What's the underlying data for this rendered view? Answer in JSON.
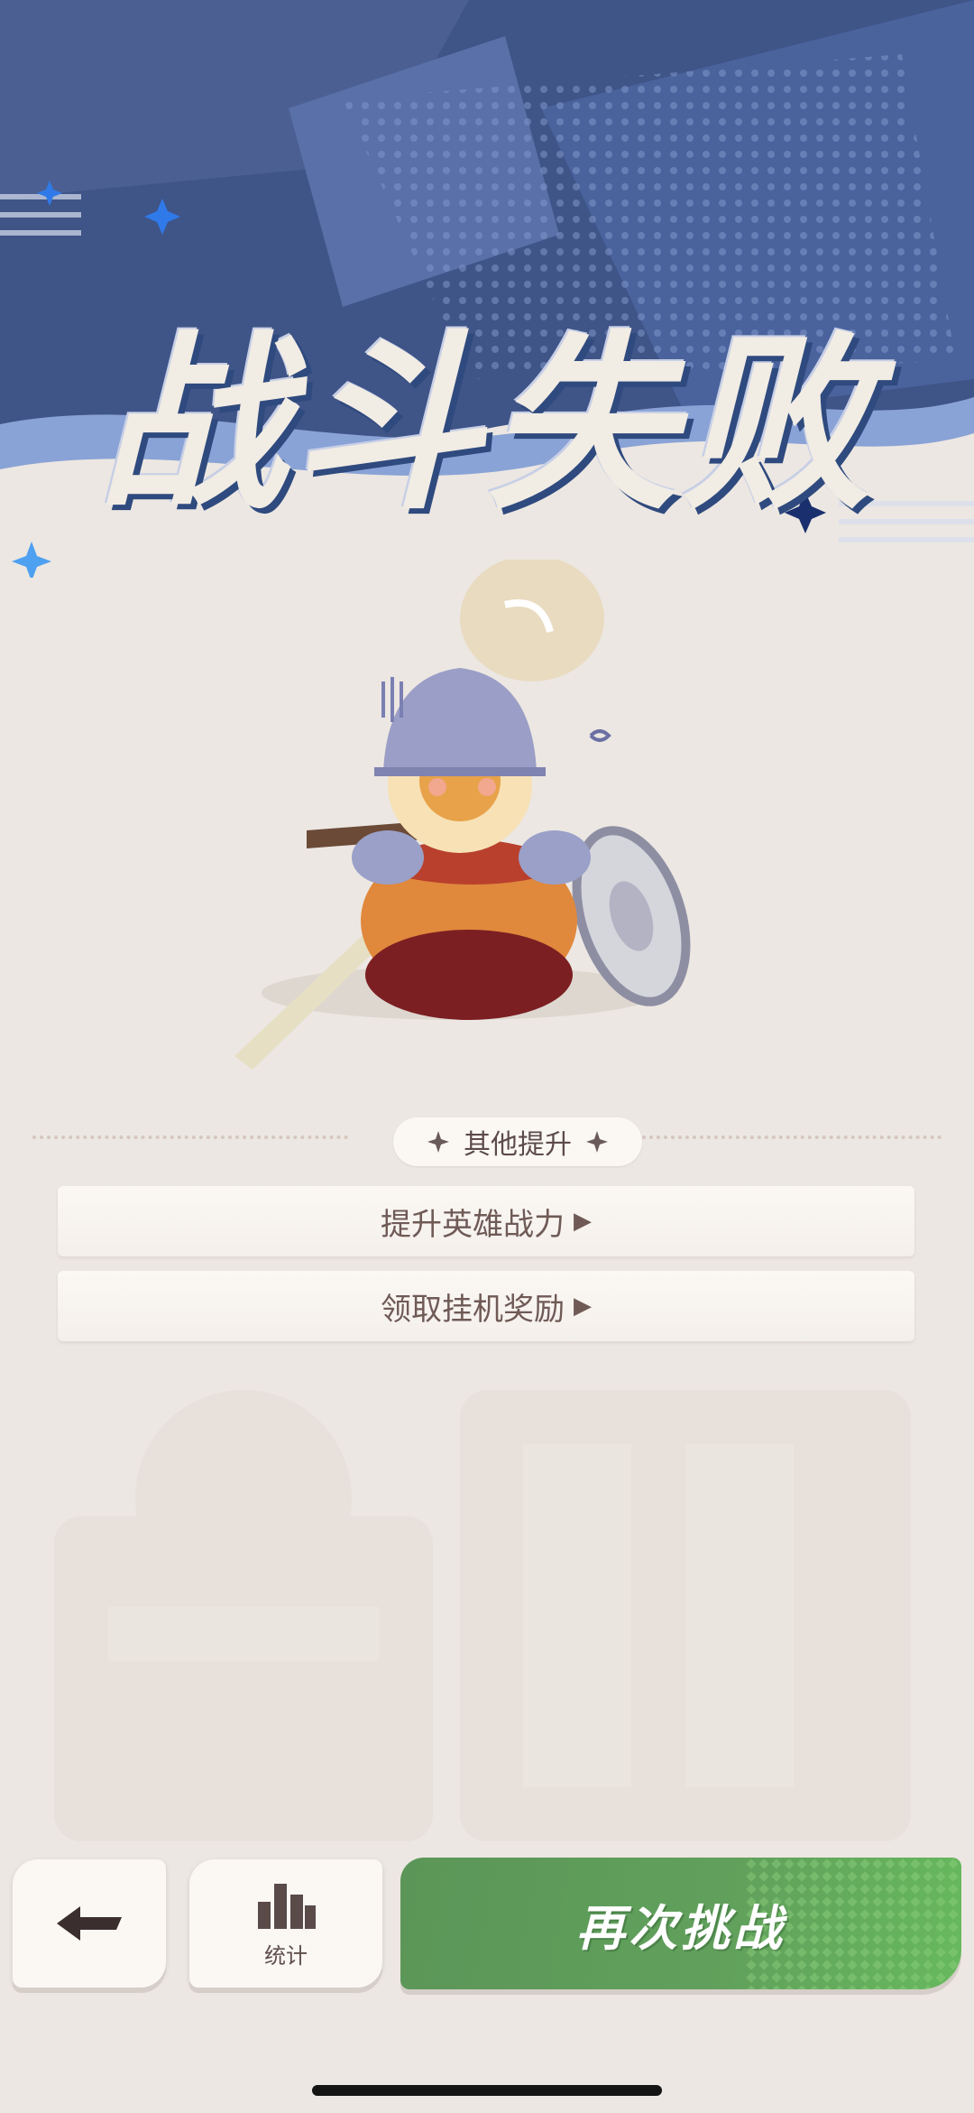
{
  "title": "战斗失败",
  "section": {
    "label": "其他提升"
  },
  "options": [
    {
      "label": "提升英雄战力"
    },
    {
      "label": "领取挂机奖励"
    }
  ],
  "buttons": {
    "back_icon": "arrow-left-icon",
    "stats_label": "统计",
    "stats_icon": "bar-chart-icon",
    "retry_label": "再次挑战"
  },
  "colors": {
    "banner_blue": "#3f5487",
    "banner_light": "#6c84c0",
    "retry_green": "#5f9d5a",
    "background": "#ece7e2",
    "text_brown": "#6f5a56"
  }
}
